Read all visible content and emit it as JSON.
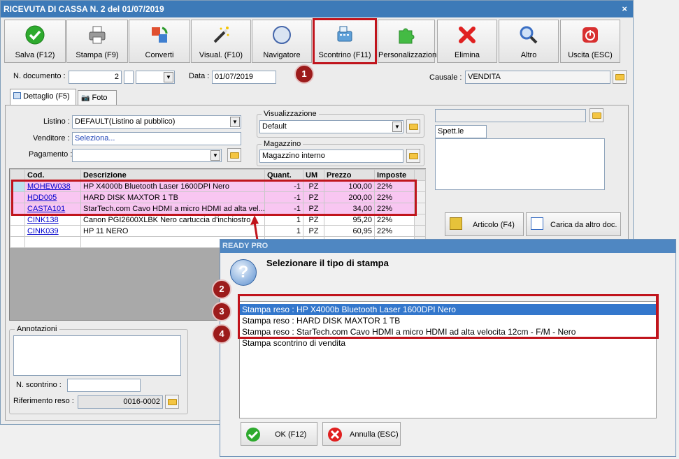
{
  "window": {
    "title": "RICEVUTA DI CASSA N. 2 del 01/07/2019",
    "close": "×"
  },
  "toolbar": [
    {
      "label": "Salva (F12)",
      "icon": "check-icon",
      "color": "#2eaa2e"
    },
    {
      "label": "Stampa (F9)",
      "icon": "printer-icon",
      "color": "#777777"
    },
    {
      "label": "Converti",
      "icon": "convert-icon",
      "color": "#3f7fd0"
    },
    {
      "label": "Visual. (F10)",
      "icon": "magic-wand-icon",
      "color": "#444444"
    },
    {
      "label": "Navigatore",
      "icon": "compass-icon",
      "color": "#4466aa"
    },
    {
      "label": "Scontrino (F11)",
      "icon": "cash-register-icon",
      "color": "#5fa0d8"
    },
    {
      "label": "Personalizzazioni",
      "icon": "puzzle-icon",
      "color": "#44bb44"
    },
    {
      "label": "Elimina",
      "icon": "delete-x-icon",
      "color": "#e02020"
    },
    {
      "label": "Altro",
      "icon": "magnifier-icon",
      "color": "#3b6fc4"
    },
    {
      "label": "Uscita (ESC)",
      "icon": "power-icon",
      "color": "#d83030"
    }
  ],
  "header": {
    "doc_label": "N. documento :",
    "doc_value": "2",
    "data_label": "Data :",
    "data_value": "01/07/2019",
    "causale_label": "Causale :",
    "causale_value": "VENDITA"
  },
  "tabs": [
    {
      "label": "Dettaglio (F5)"
    },
    {
      "label": "Foto"
    }
  ],
  "form": {
    "listino_label": "Listino :",
    "listino_value": "DEFAULT(Listino al pubblico)",
    "venditore_label": "Venditore :",
    "venditore_value": "Seleziona...",
    "pagamento_label": "Pagamento :",
    "visualizzazione_label": "Visualizzazione",
    "visualizzazione_value": "Default",
    "magazzino_label": "Magazzino",
    "magazzino_value": "Magazzino interno",
    "cliente_value": "Spett.le"
  },
  "grid": {
    "headers": [
      "Cod.",
      "Descrizione",
      "Quant.",
      "UM",
      "Prezzo",
      "Imposte"
    ],
    "rows": [
      {
        "cod": "MOHEW038",
        "desc": "HP X4000b Bluetooth Laser 1600DPI Nero",
        "qty": "-1",
        "um": "PZ",
        "price": "100,00",
        "tax": "22%"
      },
      {
        "cod": "HDD005",
        "desc": "HARD DISK MAXTOR 1 TB",
        "qty": "-1",
        "um": "PZ",
        "price": "200,00",
        "tax": "22%"
      },
      {
        "cod": "CASTA101",
        "desc": "StarTech.com Cavo HDMI a micro HDMI ad alta vel...",
        "qty": "-1",
        "um": "PZ",
        "price": "34,00",
        "tax": "22%"
      },
      {
        "cod": "CINK138",
        "desc": "Canon PGI2600XLBK Nero cartuccia d'inchiostro",
        "qty": "1",
        "um": "PZ",
        "price": "95,20",
        "tax": "22%"
      },
      {
        "cod": "CINK039",
        "desc": "HP 11 NERO",
        "qty": "1",
        "um": "PZ",
        "price": "60,95",
        "tax": "22%"
      }
    ]
  },
  "side_buttons": {
    "articolo": "Articolo (F4)",
    "carica": "Carica da altro doc."
  },
  "bottom": {
    "annotazioni_label": "Annotazioni",
    "scontrino_label": "N. scontrino :",
    "riferimento_label": "Riferimento reso :",
    "riferimento_value": "0016-0002"
  },
  "dialog": {
    "title": "READY PRO",
    "heading": "Selezionare il tipo di stampa",
    "items": [
      "Stampa reso : HP X4000b Bluetooth Laser 1600DPI Nero",
      "Stampa reso : HARD DISK MAXTOR 1 TB",
      "Stampa reso : StarTech.com Cavo HDMI a micro HDMI ad alta velocita 12cm - F/M - Nero",
      "Stampa scontrino di vendita"
    ],
    "ok": "OK (F12)",
    "cancel": "Annulla (ESC)"
  },
  "callouts": [
    "1",
    "2",
    "3",
    "4"
  ],
  "colors": {
    "highlight": "#c0141c",
    "selection": "#3377cc",
    "pink_row": "#f8c6f1",
    "title_bar": "#3d7ab8"
  }
}
